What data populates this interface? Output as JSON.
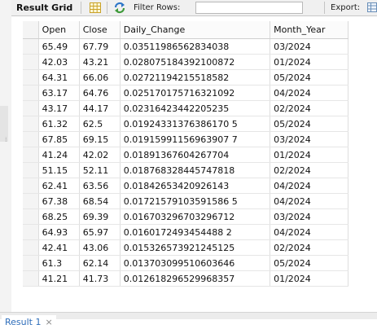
{
  "toolbar": {
    "title": "Result Grid",
    "filter_label": "Filter Rows:",
    "filter_value": "",
    "export_label": "Export:",
    "icons": [
      "grid-icon",
      "refresh-icon",
      "export-icon"
    ]
  },
  "grid": {
    "columns": [
      "Open",
      "Close",
      "Daily_Change",
      "Month_Year"
    ],
    "rows": [
      [
        "65.49",
        "67.79",
        "0.03511986562834038",
        "03/2024"
      ],
      [
        "42.03",
        "43.21",
        "0.028075184392100872",
        "01/2024"
      ],
      [
        "64.31",
        "66.06",
        "0.02721194215518582",
        "05/2024"
      ],
      [
        "63.17",
        "64.76",
        "0.025170175716321092",
        "04/2024"
      ],
      [
        "43.17",
        "44.17",
        "0.02316423442205235",
        "02/2024"
      ],
      [
        "61.32",
        "62.5",
        "0.01924331376386170 5",
        "05/2024"
      ],
      [
        "67.85",
        "69.15",
        "0.01915991156963907 7",
        "03/2024"
      ],
      [
        "41.24",
        "42.02",
        "0.01891367604267704",
        "01/2024"
      ],
      [
        "51.15",
        "52.11",
        "0.018768328445747818",
        "02/2024"
      ],
      [
        "62.41",
        "63.56",
        "0.01842653420926143",
        "04/2024"
      ],
      [
        "67.38",
        "68.54",
        "0.01721579103591586 5",
        "04/2024"
      ],
      [
        "68.25",
        "69.39",
        "0.016703296703296712",
        "03/2024"
      ],
      [
        "64.93",
        "65.97",
        "0.0160172493454488 2",
        "04/2024"
      ],
      [
        "42.41",
        "43.06",
        "0.015326573921245125",
        "02/2024"
      ],
      [
        "61.3",
        "62.14",
        "0.013703099510603646",
        "05/2024"
      ],
      [
        "41.21",
        "41.73",
        "0.012618296529968357",
        "01/2024"
      ]
    ]
  },
  "tabs": [
    {
      "label": "Result 1",
      "close": "×"
    }
  ],
  "colors": {
    "tab_text": "#2e6dba",
    "toolbar_bg": "#f0f0f0"
  }
}
